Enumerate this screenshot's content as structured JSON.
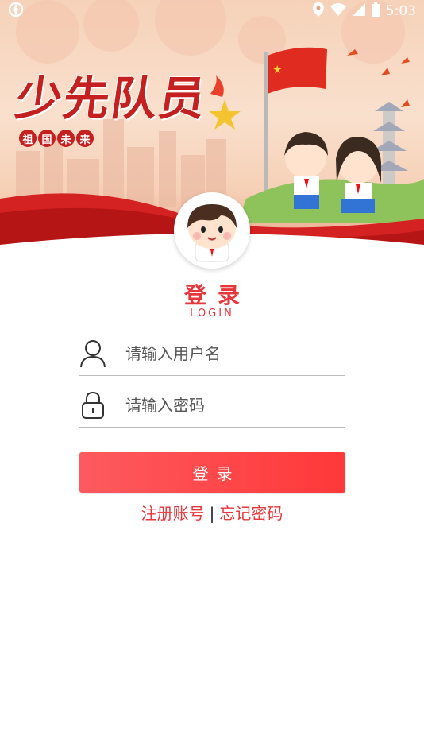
{
  "status_bar": {
    "time": "5:03"
  },
  "banner": {
    "title": "少先队员",
    "badges": [
      "祖",
      "国",
      "未",
      "来"
    ]
  },
  "login": {
    "heading": "登录",
    "subheading": "LOGIN",
    "username_placeholder": "请输入用户名",
    "password_placeholder": "请输入密码",
    "submit_label": "登录",
    "register_link": "注册账号",
    "separator": "|",
    "forgot_link": "忘记密码"
  },
  "colors": {
    "accent": "#e8363b",
    "button_start": "#fd5a5f",
    "button_end": "#ff3838",
    "banner_red": "#c51f1f"
  },
  "icons": {
    "user": "user-outline-icon",
    "password": "lock-icon",
    "status": [
      "location-icon",
      "wifi-icon",
      "signal-icon",
      "battery-icon"
    ]
  }
}
